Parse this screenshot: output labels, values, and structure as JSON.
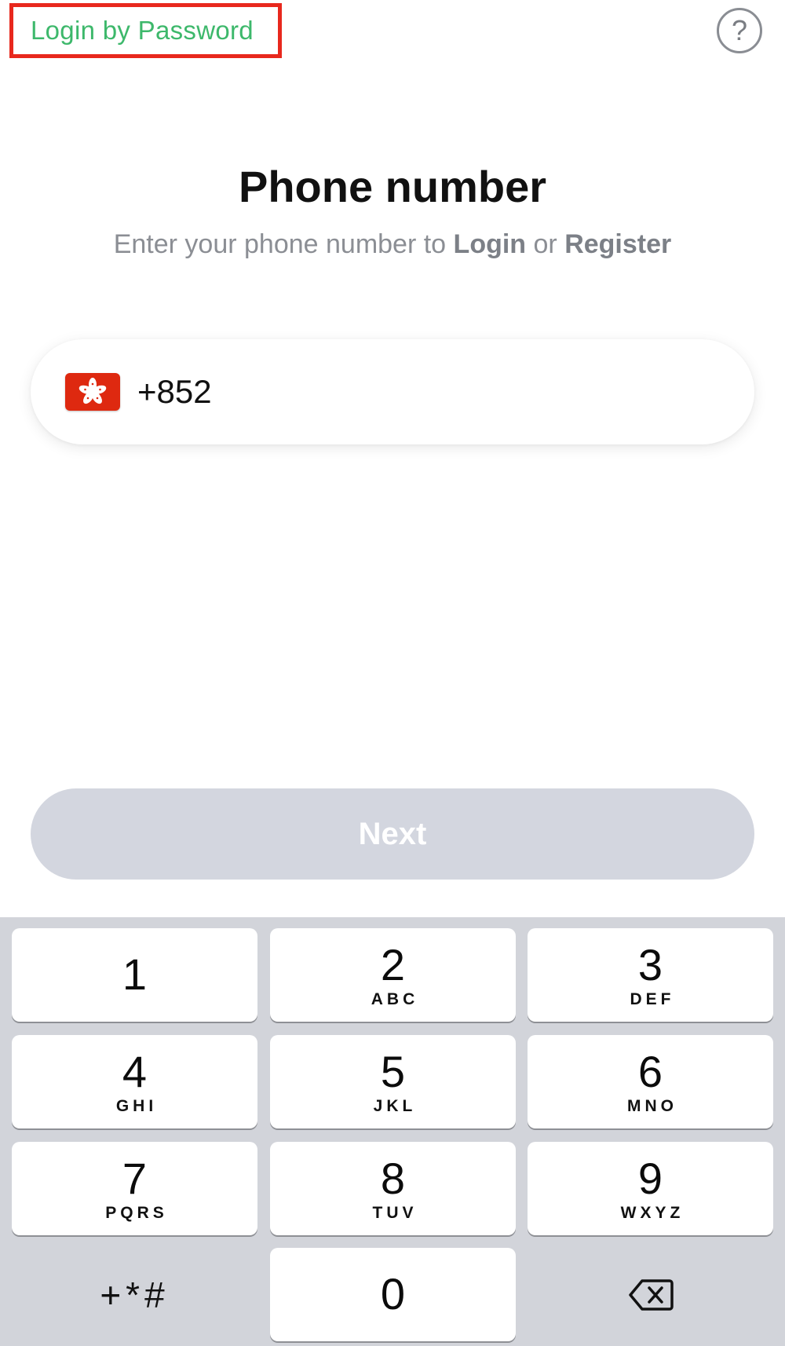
{
  "header": {
    "login_password_label": "Login by Password",
    "help_label": "?"
  },
  "main": {
    "title": "Phone number",
    "subtitle_prefix": "Enter your phone number to ",
    "subtitle_login": "Login",
    "subtitle_or": " or ",
    "subtitle_register": "Register",
    "country_flag": "hong-kong-flag-icon",
    "phone_code": "+852",
    "next_label": "Next"
  },
  "keyboard": {
    "keys": [
      {
        "digit": "1",
        "letters": ""
      },
      {
        "digit": "2",
        "letters": "ABC"
      },
      {
        "digit": "3",
        "letters": "DEF"
      },
      {
        "digit": "4",
        "letters": "GHI"
      },
      {
        "digit": "5",
        "letters": "JKL"
      },
      {
        "digit": "6",
        "letters": "MNO"
      },
      {
        "digit": "7",
        "letters": "PQRS"
      },
      {
        "digit": "8",
        "letters": "TUV"
      },
      {
        "digit": "9",
        "letters": "WXYZ"
      },
      {
        "digit": "0",
        "letters": ""
      }
    ],
    "symbols_label": "+*#",
    "backspace_icon": "backspace-icon"
  },
  "colors": {
    "accent_green": "#3db86b",
    "highlight_red": "#e8281d",
    "button_disabled": "#d3d6df",
    "keyboard_bg": "#d2d4da"
  }
}
